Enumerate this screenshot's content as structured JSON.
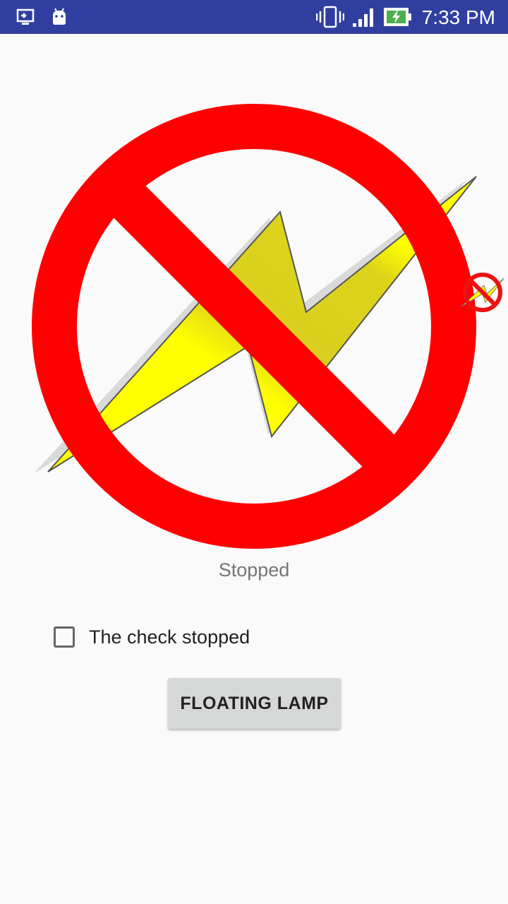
{
  "status_bar": {
    "time": "7:33 PM",
    "color": "#303f9f",
    "left_icons": [
      "screen-cast-icon",
      "android-icon"
    ],
    "right_icons": [
      "vibrate-icon",
      "signal-icon",
      "battery-charging-icon"
    ]
  },
  "main": {
    "hero_icon": "no-flash-icon",
    "status_text": "Stopped",
    "checkbox": {
      "label": "The check stopped",
      "checked": false
    },
    "button": {
      "label": "FLOATING LAMP"
    }
  },
  "overlay": {
    "floating_icon": "no-flash-icon"
  },
  "colors": {
    "prohibit_red": "#ff0000",
    "bolt_yellow": "#ffff00",
    "background": "#fafafa"
  }
}
